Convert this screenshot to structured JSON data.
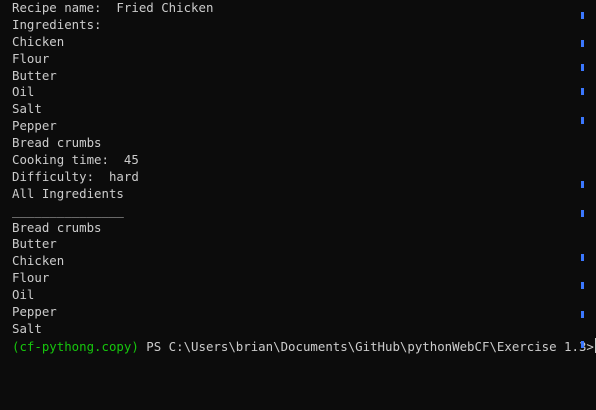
{
  "output_lines": [
    "Recipe name:  Fried Chicken",
    "Ingredients:",
    "Chicken",
    "Flour",
    "Butter",
    "Oil",
    "Salt",
    "Pepper",
    "Bread crumbs",
    "Cooking time:  45",
    "Difficulty:  hard",
    "All Ingredients",
    "_______________",
    "Bread crumbs",
    "Butter",
    "Chicken",
    "Flour",
    "Oil",
    "Pepper",
    "Salt"
  ],
  "prompt": {
    "env": "(cf-pythong.copy)",
    "path": " PS C:\\Users\\brian\\Documents\\GitHub\\pythonWebCF\\Exercise 1.3>"
  },
  "colors": {
    "background": "#0c0c0c",
    "text": "#cccccc",
    "prompt_env": "#16c60c",
    "scroll_marker": "#3b78ff"
  }
}
